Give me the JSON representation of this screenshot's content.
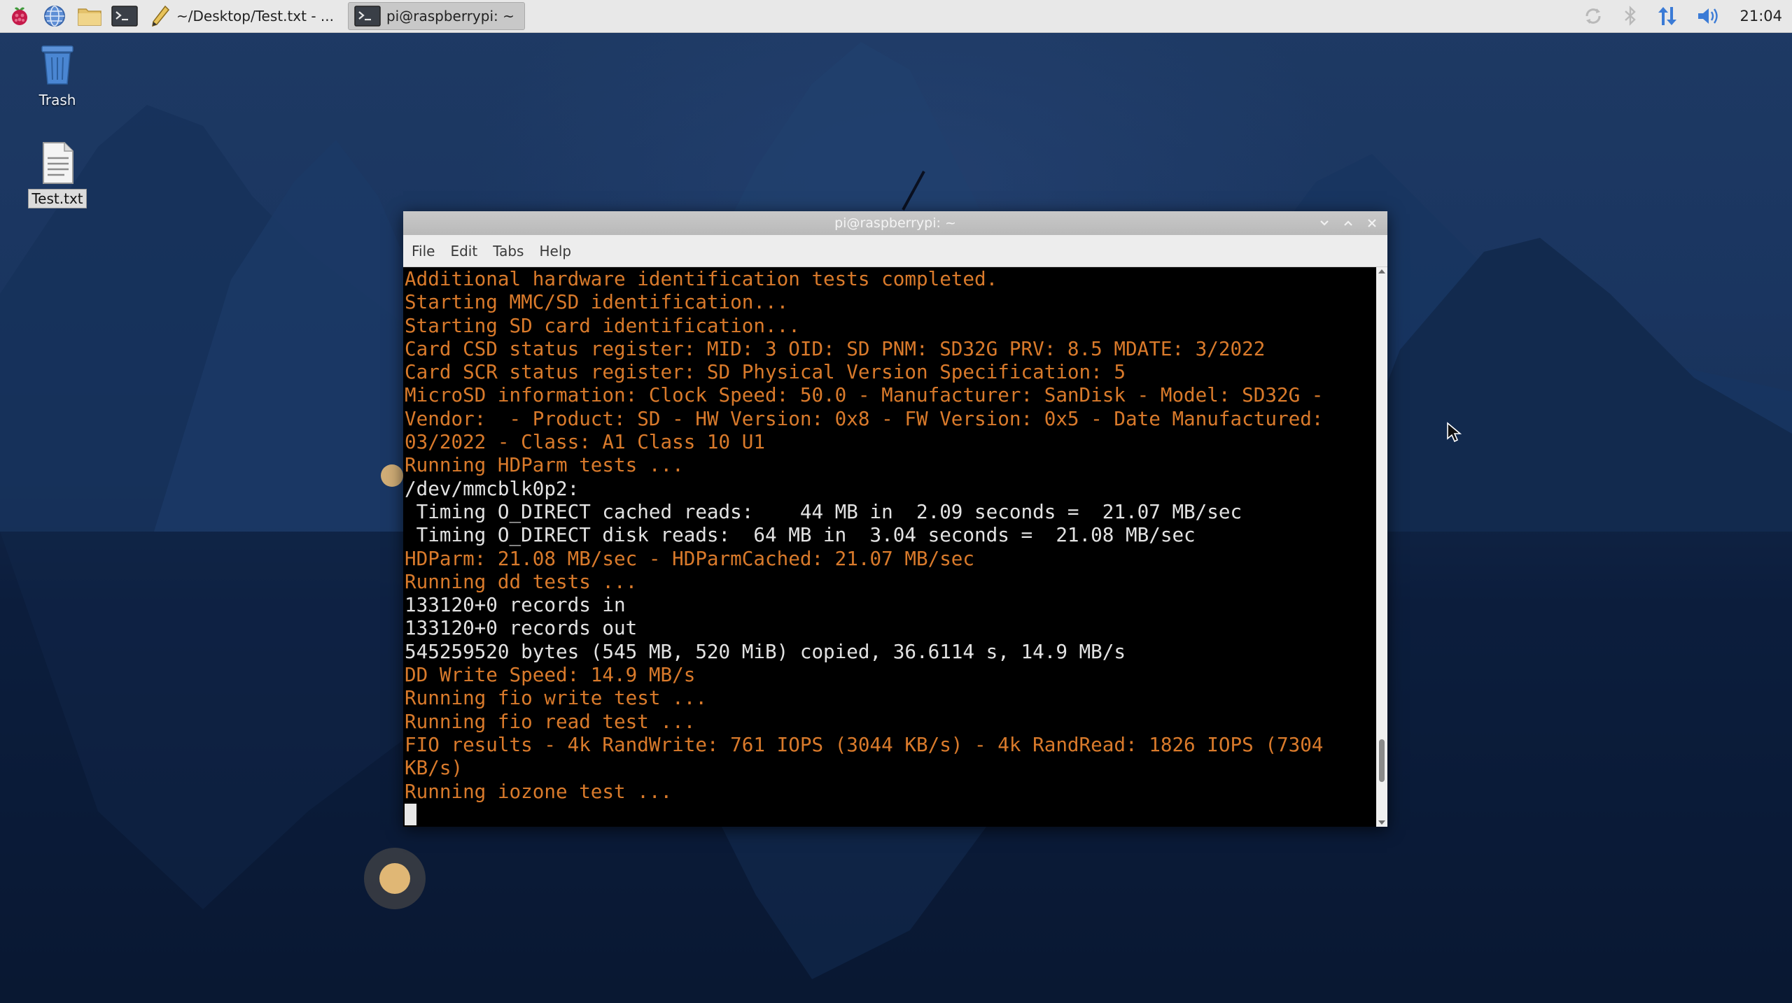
{
  "panel": {
    "taskbar": [
      {
        "label": "~/Desktop/Test.txt - ...",
        "icon": "pencil-icon",
        "active": false
      },
      {
        "label": "pi@raspberrypi: ~",
        "icon": "terminal-icon",
        "active": true
      }
    ],
    "tray_icons": [
      "sync-icon",
      "bluetooth-icon",
      "network-icon",
      "volume-icon"
    ],
    "clock": "21:04"
  },
  "desktop": {
    "icons": [
      {
        "label": "Trash",
        "icon": "trash-icon"
      },
      {
        "label": "Test.txt",
        "icon": "text-file-icon"
      }
    ]
  },
  "terminal": {
    "title": "pi@raspberrypi: ~",
    "menu": [
      "File",
      "Edit",
      "Tabs",
      "Help"
    ],
    "lines": [
      {
        "text": "Additional hardware identification tests completed.",
        "color": "#d97a2b"
      },
      {
        "text": "Starting MMC/SD identification...",
        "color": "#d97a2b"
      },
      {
        "text": "Starting SD card identification...",
        "color": "#d97a2b"
      },
      {
        "text": "Card CSD status register: MID: 3 OID: SD PNM: SD32G PRV: 8.5 MDATE: 3/2022",
        "color": "#d97a2b"
      },
      {
        "text": "Card SCR status register: SD Physical Version Specification: 5",
        "color": "#d97a2b"
      },
      {
        "text": "MicroSD information: Clock Speed: 50.0 - Manufacturer: SanDisk - Model: SD32G -",
        "color": "#d97a2b"
      },
      {
        "text": "Vendor:  - Product: SD - HW Version: 0x8 - FW Version: 0x5 - Date Manufactured:",
        "color": "#d97a2b"
      },
      {
        "text": "03/2022 - Class: A1 Class 10 U1",
        "color": "#d97a2b"
      },
      {
        "text": "Running HDParm tests ...",
        "color": "#d97a2b"
      },
      {
        "text": "/dev/mmcblk0p2:",
        "color": "#e2e2e2"
      },
      {
        "text": " Timing O_DIRECT cached reads:    44 MB in  2.09 seconds =  21.07 MB/sec",
        "color": "#e2e2e2"
      },
      {
        "text": " Timing O_DIRECT disk reads:  64 MB in  3.04 seconds =  21.08 MB/sec",
        "color": "#e2e2e2"
      },
      {
        "text": "HDParm: 21.08 MB/sec - HDParmCached: 21.07 MB/sec",
        "color": "#d97a2b"
      },
      {
        "text": "Running dd tests ...",
        "color": "#d97a2b"
      },
      {
        "text": "133120+0 records in",
        "color": "#e2e2e2"
      },
      {
        "text": "133120+0 records out",
        "color": "#e2e2e2"
      },
      {
        "text": "545259520 bytes (545 MB, 520 MiB) copied, 36.6114 s, 14.9 MB/s",
        "color": "#e2e2e2"
      },
      {
        "text": "DD Write Speed: 14.9 MB/s",
        "color": "#d97a2b"
      },
      {
        "text": "Running fio write test ...",
        "color": "#d97a2b"
      },
      {
        "text": "Running fio read test ...",
        "color": "#d97a2b"
      },
      {
        "text": "FIO results - 4k RandWrite: 761 IOPS (3044 KB/s) - 4k RandRead: 1826 IOPS (7304",
        "color": "#d97a2b"
      },
      {
        "text": "KB/s)",
        "color": "#d97a2b"
      },
      {
        "text": "Running iozone test ...",
        "color": "#d97a2b"
      }
    ],
    "scroll_position": 0.93,
    "scroll_visible_fraction": 0.08
  }
}
